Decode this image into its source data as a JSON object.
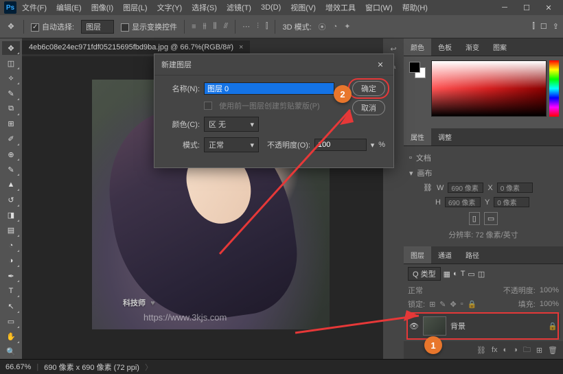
{
  "menu": {
    "file": "文件(F)",
    "edit": "编辑(E)",
    "image": "图像(I)",
    "layer": "图层(L)",
    "type": "文字(Y)",
    "select": "选择(S)",
    "filter": "滤镜(T)",
    "threed": "3D(D)",
    "view": "视图(V)",
    "plugins": "增效工具",
    "window": "窗口(W)",
    "help": "帮助(H)"
  },
  "options": {
    "autoSelect": "自动选择:",
    "autoSelectTarget": "图层",
    "showTransform": "显示变换控件",
    "threeDMode": "3D 模式:"
  },
  "tab": {
    "title": "4eb6c08e24ec971fdf05215695fbd9ba.jpg @ 66.7%(RGB/8#)"
  },
  "watermark": {
    "text": "科技师",
    "url": "https://www.3kjs.com"
  },
  "dialog": {
    "title": "新建图层",
    "nameLabel": "名称(N):",
    "nameValue": "图层 0",
    "clipMask": "使用前一图层创建剪贴蒙版(P)",
    "colorLabel": "颜色(C):",
    "colorValue": "区 无",
    "modeLabel": "模式:",
    "modeValue": "正常",
    "opacityLabel": "不透明度(O):",
    "opacityValue": "100",
    "opacityUnit": "%",
    "ok": "确定",
    "cancel": "取消"
  },
  "panels": {
    "colorTabs": {
      "color": "颜色",
      "swatches": "色板",
      "gradients": "渐变",
      "patterns": "图案"
    },
    "propsTabs": {
      "properties": "属性",
      "adjustments": "调整"
    },
    "props": {
      "doc": "文档",
      "canvas": "画布",
      "w": "W",
      "h": "H",
      "wVal": "690 像素",
      "hVal": "690 像素",
      "x": "X",
      "y": "Y",
      "xVal": "0 像素",
      "yVal": "0 像素",
      "res": "分辨率: 72 像素/英寸"
    },
    "layerTabs": {
      "layers": "图层",
      "channels": "通道",
      "paths": "路径"
    },
    "layers": {
      "kind": "Q 类型",
      "blend": "正常",
      "opacity": "不透明度:",
      "opacityVal": "100%",
      "lock": "锁定:",
      "fill": "填充:",
      "fillVal": "100%",
      "bgName": "背景"
    }
  },
  "status": {
    "zoom": "66.67%",
    "docsize": "690 像素 x 690 像素 (72 ppi)"
  },
  "callouts": {
    "one": "1",
    "two": "2"
  },
  "chart_data": null
}
